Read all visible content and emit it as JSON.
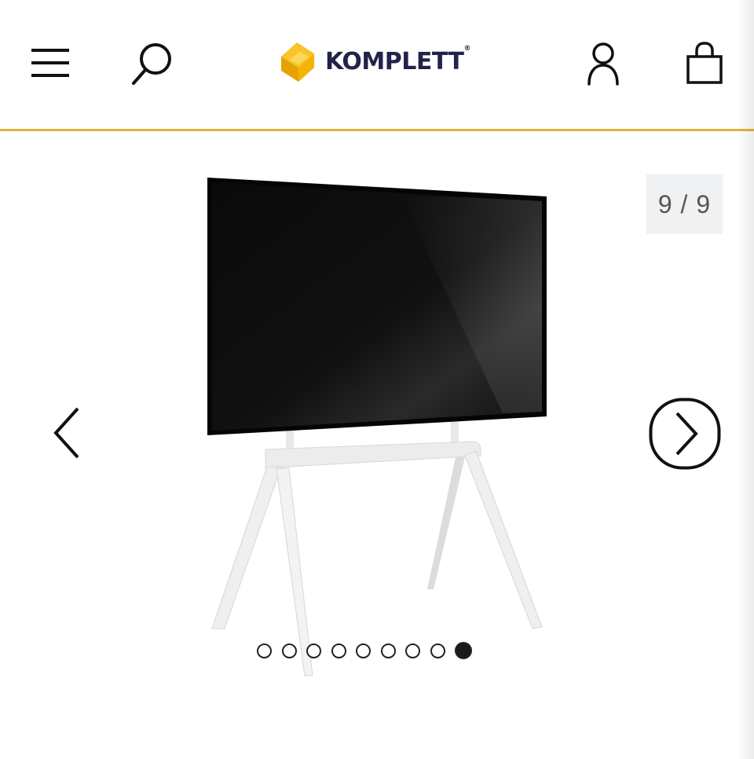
{
  "header": {
    "logo_text": "KOMPLETT",
    "logo_mark": "®",
    "icons": {
      "menu": "hamburger-menu-icon",
      "search": "search-icon",
      "account": "user-icon",
      "cart": "shopping-bag-icon"
    }
  },
  "colors": {
    "accent": "#e2b33b",
    "logo_yellow": "#f4b400",
    "logo_navy": "#22234a",
    "counter_bg": "#f0f1f2"
  },
  "gallery": {
    "counter": "9 / 9",
    "current_index": 9,
    "total_images": 9,
    "product_image": "tv-on-white-easel-stand",
    "prev_icon": "chevron-left-icon",
    "next_icon": "chevron-right-circle-icon"
  }
}
